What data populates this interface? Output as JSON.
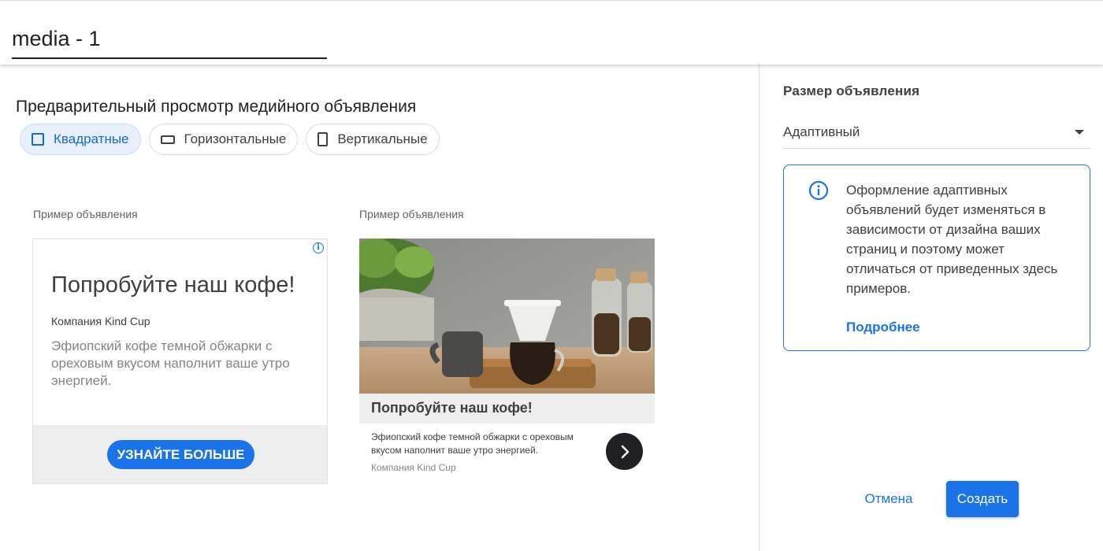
{
  "header": {
    "title_value": "media - 1"
  },
  "preview": {
    "title": "Предварительный просмотр медийного объявления",
    "chips": [
      {
        "label": "Квадратные",
        "icon": "square-icon",
        "active": true
      },
      {
        "label": "Горизонтальные",
        "icon": "landscape-icon",
        "active": false
      },
      {
        "label": "Вертикальные",
        "icon": "portrait-icon",
        "active": false
      }
    ],
    "ad_square": {
      "label": "Пример объявления",
      "headline": "Попробуйте наш кофе!",
      "company": "Компания Kind Cup",
      "description": "Эфиопский кофе темной обжарки с ореховым вкусом наполнит ваше утро энергией.",
      "cta": "УЗНАЙТЕ БОЛЬШЕ"
    },
    "ad_image": {
      "label": "Пример объявления",
      "headline": "Попробуйте наш кофе!",
      "description": "Эфиопский кофе темной обжарки с ореховым вкусом наполнит ваше утро энергией.",
      "company": "Компания Kind Cup"
    }
  },
  "sidebar": {
    "size_label": "Размер объявления",
    "size_value": "Адаптивный",
    "notice_text": "Оформление адаптивных объявлений будет изменяться в зависимости от дизайна ваших страниц и поэтому может отличаться от приведенных здесь примеров.",
    "notice_link": "Подробнее"
  },
  "actions": {
    "cancel": "Отмена",
    "create": "Создать"
  },
  "colors": {
    "accent": "#1a73e8",
    "chip_active_bg": "#e8f0fe",
    "text": "#202124"
  }
}
